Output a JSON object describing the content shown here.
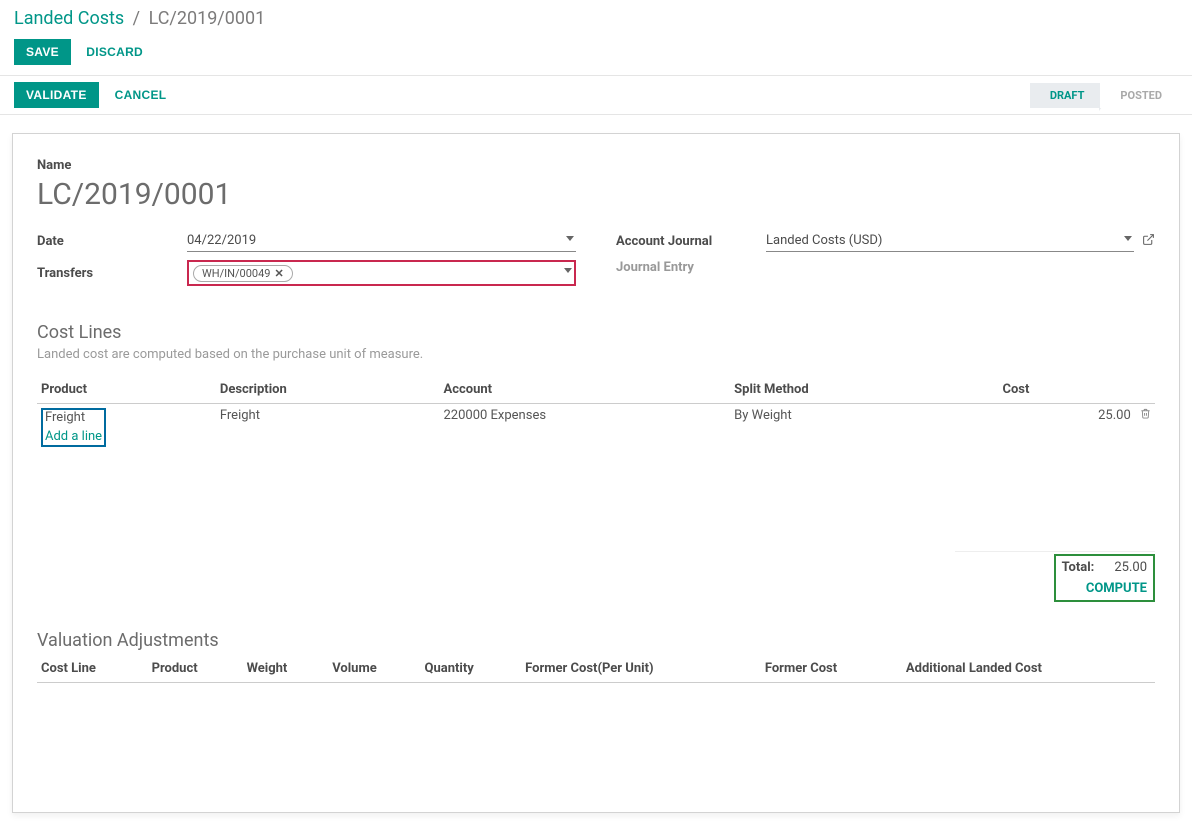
{
  "breadcrumb": {
    "root": "Landed Costs",
    "current": "LC/2019/0001"
  },
  "topbar": {
    "save": "SAVE",
    "discard": "DISCARD"
  },
  "statusbar": {
    "validate": "VALIDATE",
    "cancel": "CANCEL",
    "draft": "DRAFT",
    "posted": "POSTED"
  },
  "form": {
    "name_label": "Name",
    "name_value": "LC/2019/0001",
    "date_label": "Date",
    "date_value": "04/22/2019",
    "transfers_label": "Transfers",
    "transfers_tag": "WH/IN/00049",
    "journal_label": "Account Journal",
    "journal_value": "Landed Costs (USD)",
    "entry_label": "Journal Entry"
  },
  "cost_lines": {
    "title": "Cost Lines",
    "note": "Landed cost are computed based on the purchase unit of measure.",
    "headers": {
      "product": "Product",
      "description": "Description",
      "account": "Account",
      "split_method": "Split Method",
      "cost": "Cost"
    },
    "row": {
      "product": "Freight",
      "description": "Freight",
      "account": "220000 Expenses",
      "split_method": "By Weight",
      "cost": "25.00"
    },
    "add_line": "Add a line"
  },
  "totals": {
    "total_label": "Total:",
    "total_value": "25.00",
    "compute": "COMPUTE"
  },
  "valuation": {
    "title": "Valuation Adjustments",
    "headers": {
      "cost_line": "Cost Line",
      "product": "Product",
      "weight": "Weight",
      "volume": "Volume",
      "quantity": "Quantity",
      "former_cost_unit": "Former Cost(Per Unit)",
      "former_cost": "Former Cost",
      "additional": "Additional Landed Cost"
    }
  }
}
